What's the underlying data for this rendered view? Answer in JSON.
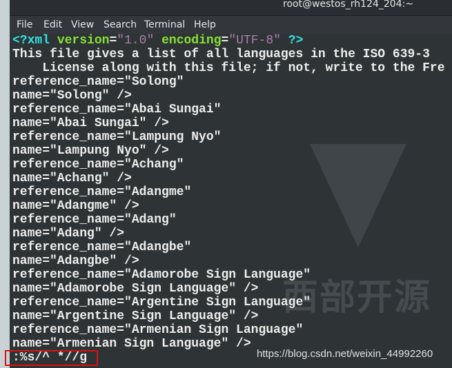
{
  "window": {
    "title": "root@westos_rh124_204:~"
  },
  "menu": [
    "File",
    "Edit",
    "View",
    "Search",
    "Terminal",
    "Help"
  ],
  "xml_decl": {
    "open": "<?xml",
    "version_attr": "version",
    "version_val": "\"1.0\"",
    "encoding_attr": "encoding",
    "encoding_val": "\"UTF-8\"",
    "close": "?>"
  },
  "lines": [
    "This file gives a list of all languages in the ISO 639-3",
    "    License along with this file; if not, write to the Fre",
    "reference_name=\"Solong\"",
    "name=\"Solong\" />",
    "reference_name=\"Abai Sungai\"",
    "name=\"Abai Sungai\" />",
    "reference_name=\"Lampung Nyo\"",
    "name=\"Lampung Nyo\" />",
    "reference_name=\"Achang\"",
    "name=\"Achang\" />",
    "reference_name=\"Adangme\"",
    "name=\"Adangme\" />",
    "reference_name=\"Adang\"",
    "name=\"Adang\" />",
    "reference_name=\"Adangbe\"",
    "name=\"Adangbe\" />",
    "reference_name=\"Adamorobe Sign Language\"",
    "name=\"Adamorobe Sign Language\" />",
    "reference_name=\"Argentine Sign Language\"",
    "name=\"Argentine Sign Language\" />",
    "reference_name=\"Armenian Sign Language\"",
    "name=\"Armenian Sign Language\" />"
  ],
  "command": ":%s/^ *//g",
  "watermark_url": "https://blog.csdn.net/weixin_44992260",
  "logo_text": "西部开源",
  "colors": {
    "highlight_box": "#e01010",
    "tag": "#34e2e2",
    "attr": "#8ae234",
    "string": "#ad7fa8"
  }
}
